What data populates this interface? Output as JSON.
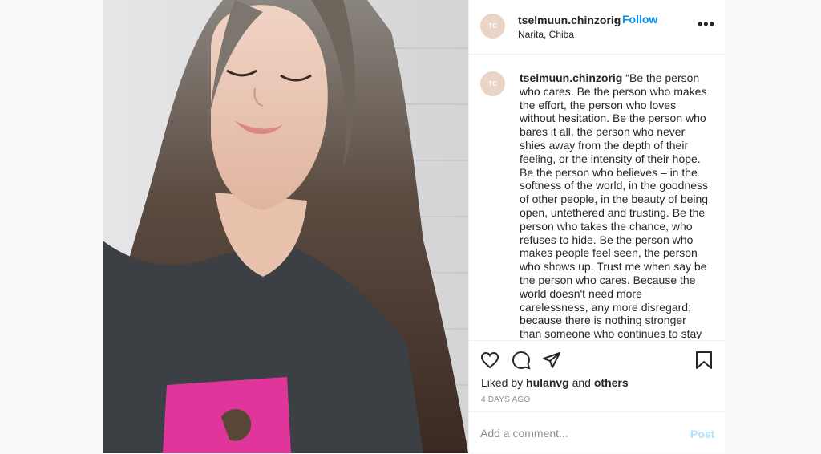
{
  "post": {
    "author": {
      "username": "tselmuun.chinzorig",
      "avatar_initials": "TC",
      "location": "Narita, Chiba"
    },
    "follow_separator": "•",
    "follow_label": "Follow",
    "more_label": "•••",
    "caption": {
      "username": "tselmuun.chinzorig",
      "text": "“Be the person who cares. Be the person who makes the effort, the person who loves without hesitation. Be the person who bares it all, the person who never shies away from the depth of their feeling, or the intensity of their hope. Be the person who believes – in the softness of the world, in the goodness of other people, in the beauty of being open, untethered and trusting. Be the person who takes the chance, who refuses to hide. Be the person who makes people feel seen, the person who shows up. Trust me when say be the person who cares. Because the world doesn't need more carelessness, any more disregard; because there is nothing stronger than someone who continues to stay soft in a world that hasn't always been kind to"
    },
    "likes": {
      "prefix": "Liked by",
      "user": "hulanvg",
      "conjunction": "and",
      "others": "others"
    },
    "age": "4 DAYS AGO",
    "comment": {
      "placeholder": "Add a comment...",
      "post_label": "Post"
    },
    "icons": {
      "like": "heart-icon",
      "comment": "comment-icon",
      "share": "share-icon",
      "save": "bookmark-icon",
      "more": "more-options-icon"
    },
    "colors": {
      "link_blue": "#0095f6",
      "post_disabled": "#b2dffc",
      "muted": "#8e8e8e",
      "avatar_bg": "#e9d4c6"
    }
  }
}
